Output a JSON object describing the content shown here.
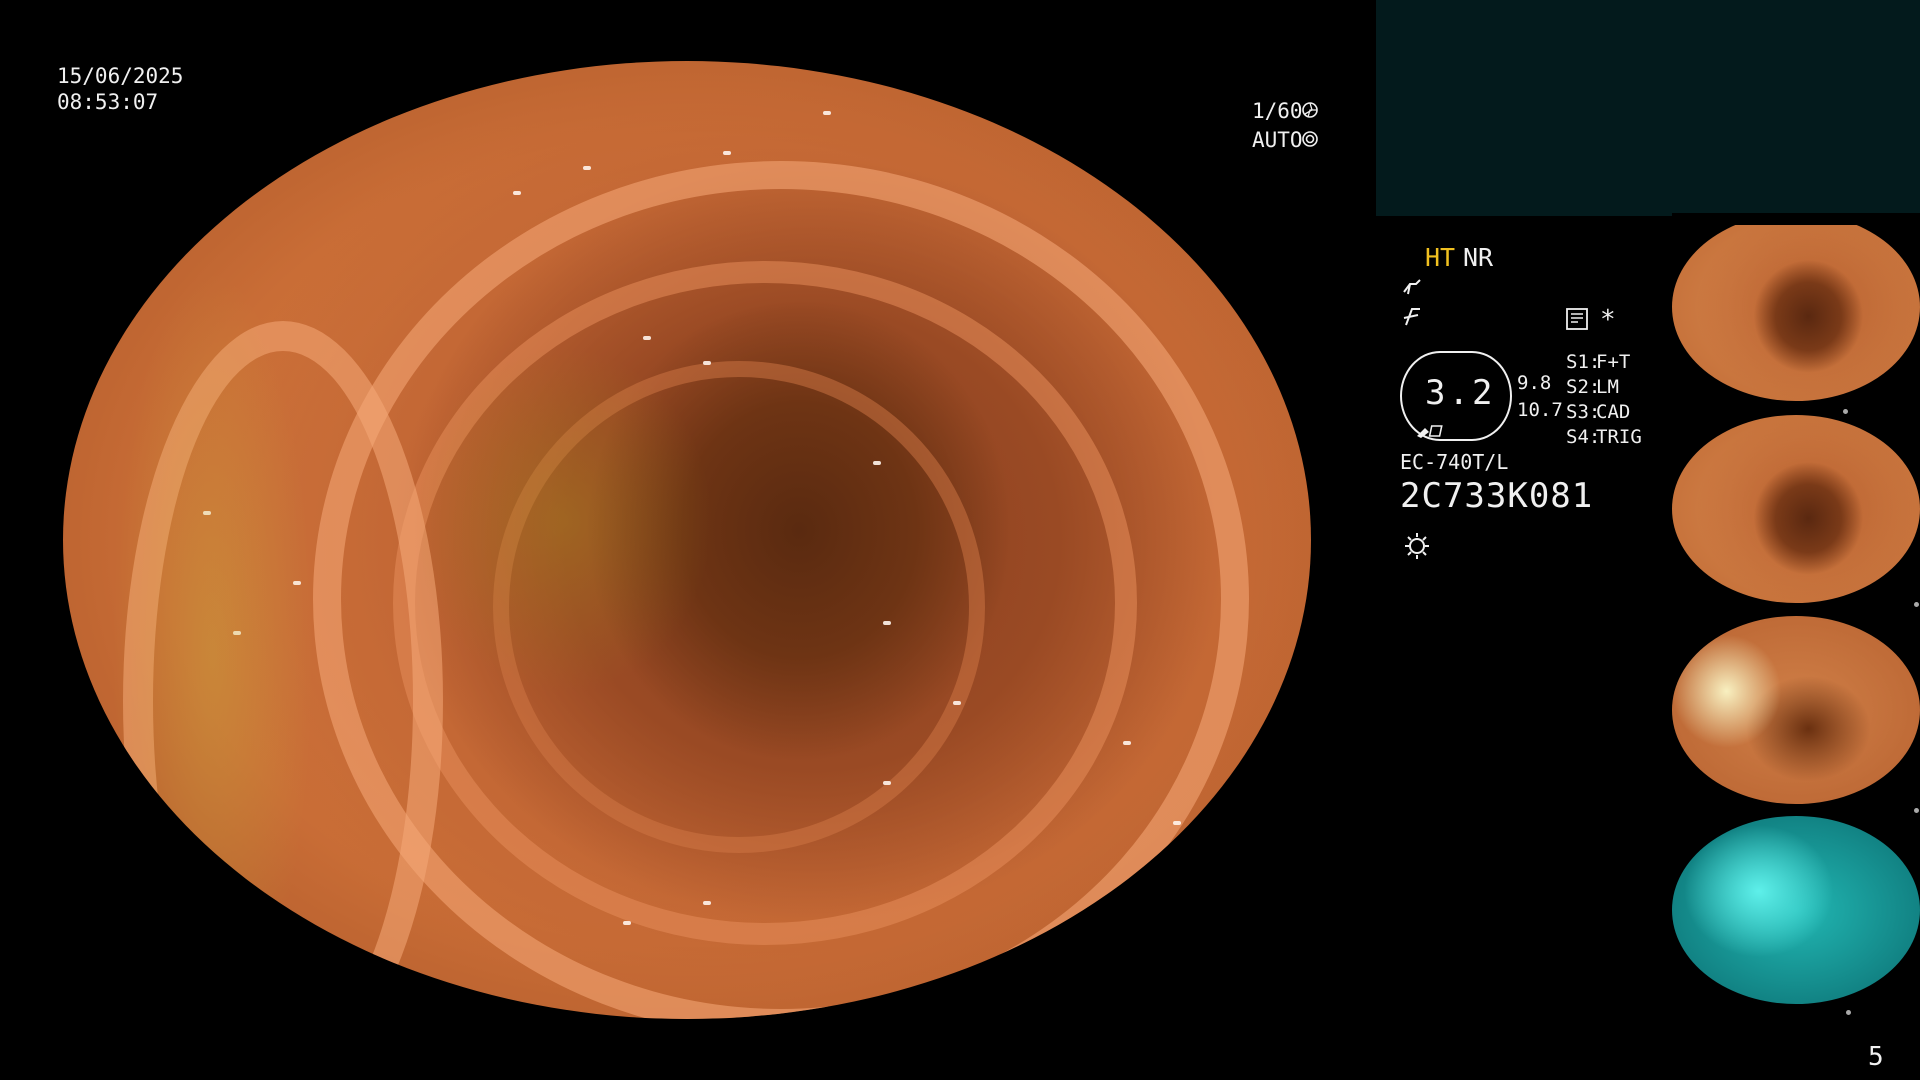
{
  "overlay": {
    "date": "15/06/2025",
    "time": "08:53:07",
    "shutter": "1/60",
    "shutter_icon": "shutter-icon",
    "iris_mode": "AUTO",
    "iris_icon": "iris-icon"
  },
  "panel": {
    "mode_ht": "HT",
    "mode_nr": "NR",
    "memory_icon": "memory-card-icon",
    "asterisk": "*",
    "scale_value": "3.2",
    "scale_right_top": "9.8",
    "scale_right_bottom": "10.7",
    "switches": [
      {
        "key": "S1:",
        "value": "F+T"
      },
      {
        "key": "S2:",
        "value": "LM"
      },
      {
        "key": "S3:",
        "value": "CAD"
      },
      {
        "key": "S4:",
        "value": "TRIG"
      }
    ],
    "model": "EC-740T/L",
    "serial": "2C733K081",
    "light_icon": "light-source-icon",
    "page_number": "5"
  },
  "colors": {
    "accent_yellow": "#f0c020",
    "panel_bg": "#031a1c"
  }
}
